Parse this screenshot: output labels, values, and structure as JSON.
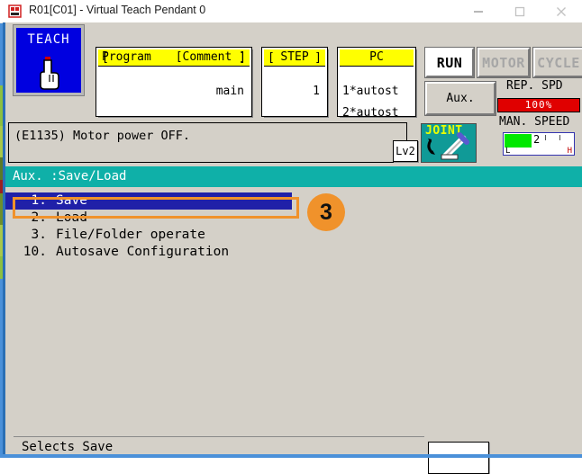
{
  "window": {
    "title": "R01[C01] - Virtual Teach Pendant 0",
    "app_icon": "robot-app-icon",
    "controls": {
      "minimize": "—",
      "maximize": "☐",
      "close": "✕"
    }
  },
  "toolbar": {
    "teach": {
      "label": "TEACH",
      "icon": "pointing-hand-icon"
    },
    "program": {
      "header_left": "Program",
      "header_right": "[Comment ]",
      "value": "main",
      "bracket_left": "[",
      "bracket_right": "]"
    },
    "step": {
      "header": "STEP",
      "value": "1",
      "bracket_left": "[",
      "bracket_right": "]"
    },
    "pc": {
      "header": "PC",
      "line1": "1*autost",
      "line2": "2*autost"
    },
    "status_chips": [
      {
        "label": "RUN",
        "active": true
      },
      {
        "label": "MOTOR",
        "active": false
      },
      {
        "label": "CYCLE",
        "active": false
      }
    ],
    "aux_label": "Aux.",
    "rep_speed": {
      "label": "REP. SPD",
      "value": "100%",
      "color": "#e00000"
    },
    "man_speed": {
      "label": "MAN. SPEED",
      "value": "2",
      "low": "L",
      "high": "H",
      "bar_color": "#00e800"
    }
  },
  "message": {
    "text": "(E1135) Motor power OFF.",
    "level_badge": "Lv2",
    "mode_icon_label": "JOINT",
    "mode_icon_name": "robot-arm-joint-icon"
  },
  "menu": {
    "header": "Aux. :Save/Load",
    "items": [
      {
        "num": "1.",
        "label": "Save",
        "selected": true
      },
      {
        "num": "2.",
        "label": "Load",
        "selected": false
      },
      {
        "num": "3.",
        "label": "File/Folder operate",
        "selected": false
      },
      {
        "num": "10.",
        "label": "Autosave Configuration",
        "selected": false
      }
    ]
  },
  "annotation": {
    "badge": "3",
    "color": "#f0922b"
  },
  "status": {
    "text": "Selects Save",
    "input_value": ""
  }
}
